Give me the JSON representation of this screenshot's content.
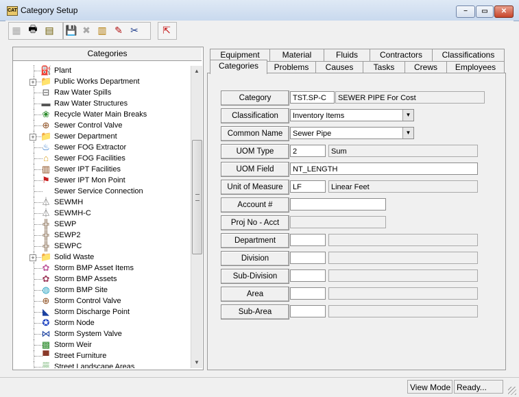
{
  "window": {
    "title": "Category Setup",
    "icon_text": "CAT"
  },
  "window_controls": {
    "minimize": "−",
    "maximize": "▭",
    "close": "✕"
  },
  "toolbar": {
    "icons": [
      "new-icon",
      "print-icon",
      "report-icon",
      "save-icon",
      "delete-icon",
      "stack-icon",
      "edit-pencil-icon",
      "cut-icon",
      "export-icon"
    ],
    "glyphs": [
      "▦",
      "🖶",
      "▤",
      "💾",
      "✖",
      "▥",
      "✎",
      "✂",
      "⇱"
    ]
  },
  "left_panel": {
    "header": "Categories"
  },
  "tree": {
    "items": [
      {
        "label": "Plant",
        "icon": "pipe-icon",
        "glyph": "⛽",
        "expandable": false
      },
      {
        "label": "Public Works Department",
        "icon": "folder-icon",
        "glyph": "📁",
        "expandable": true
      },
      {
        "label": "Raw Water Spills",
        "icon": "valve-icon",
        "glyph": "⊟",
        "expandable": false
      },
      {
        "label": "Raw Water Structures",
        "icon": "structure-icon",
        "glyph": "▬",
        "expandable": false
      },
      {
        "label": "Recycle Water Main Breaks",
        "icon": "tree-icon",
        "glyph": "❀",
        "expandable": false
      },
      {
        "label": "Sewer Control Valve",
        "icon": "valve-icon",
        "glyph": "⊕",
        "expandable": false
      },
      {
        "label": "Sewer Department",
        "icon": "folder-icon",
        "glyph": "📁",
        "expandable": true
      },
      {
        "label": "Sewer FOG Extractor",
        "icon": "extractor-icon",
        "glyph": "♨",
        "expandable": false
      },
      {
        "label": "Sewer FOG Facilities",
        "icon": "house-icon",
        "glyph": "⌂",
        "expandable": false
      },
      {
        "label": "Sewer IPT Facilities",
        "icon": "building-icon",
        "glyph": "▥",
        "expandable": false
      },
      {
        "label": "Sewer IPT Mon Point",
        "icon": "flag-icon",
        "glyph": "⚑",
        "expandable": false
      },
      {
        "label": "Sewer Service Connection",
        "icon": "",
        "glyph": "",
        "expandable": false
      },
      {
        "label": "SEWMH",
        "icon": "manhole-icon",
        "glyph": "⏃",
        "expandable": false
      },
      {
        "label": "SEWMH-C",
        "icon": "manhole-icon",
        "glyph": "⏃",
        "expandable": false
      },
      {
        "label": "SEWP",
        "icon": "pipe-segment-icon",
        "glyph": "╬",
        "expandable": false
      },
      {
        "label": "SEWP2",
        "icon": "pipe-segment-icon",
        "glyph": "╬",
        "expandable": false
      },
      {
        "label": "SEWPC",
        "icon": "pipe-segment-icon",
        "glyph": "╬",
        "expandable": false
      },
      {
        "label": "Solid Waste",
        "icon": "folder-icon",
        "glyph": "📁",
        "expandable": true
      },
      {
        "label": "Storm BMP Asset Items",
        "icon": "flower-icon",
        "glyph": "✿",
        "expandable": false
      },
      {
        "label": "Storm BMP Assets",
        "icon": "flower-icon",
        "glyph": "✿",
        "expandable": false
      },
      {
        "label": "Storm BMP Site",
        "icon": "globe-icon",
        "glyph": "◍",
        "expandable": false
      },
      {
        "label": "Storm Control Valve",
        "icon": "valve-icon",
        "glyph": "⊕",
        "expandable": false
      },
      {
        "label": "Storm Discharge Point",
        "icon": "discharge-icon",
        "glyph": "◣",
        "expandable": false
      },
      {
        "label": "Storm Node",
        "icon": "node-icon",
        "glyph": "✪",
        "expandable": false
      },
      {
        "label": "Storm System Valve",
        "icon": "valve-icon",
        "glyph": "⋈",
        "expandable": false
      },
      {
        "label": "Storm Weir",
        "icon": "weir-icon",
        "glyph": "▩",
        "expandable": false
      },
      {
        "label": "Street Furniture",
        "icon": "bench-icon",
        "glyph": "▀",
        "expandable": false
      },
      {
        "label": "Street Landscape Areas",
        "icon": "landscape-icon",
        "glyph": "▒",
        "expandable": false
      }
    ]
  },
  "tabs": {
    "back_row": [
      "Equipment",
      "Material",
      "Fluids",
      "Contractors",
      "Classifications"
    ],
    "front_row": [
      "Categories",
      "Problems",
      "Causes",
      "Tasks",
      "Crews",
      "Employees"
    ],
    "active": "Categories"
  },
  "form": {
    "category": {
      "label": "Category",
      "code": "TST.SP-C",
      "description": "SEWER PIPE For Cost"
    },
    "classification": {
      "label": "Classification",
      "value": "Inventory Items"
    },
    "common_name": {
      "label": "Common  Name",
      "value": "Sewer Pipe"
    },
    "uom_type": {
      "label": "UOM Type",
      "code": "2",
      "description": "Sum"
    },
    "uom_field": {
      "label": "UOM Field",
      "value": "NT_LENGTH"
    },
    "unit_of_measure": {
      "label": "Unit of Measure",
      "code": "LF",
      "description": "Linear Feet"
    },
    "account": {
      "label": "Account #",
      "value": ""
    },
    "proj_no": {
      "label": "Proj No - Acct",
      "value": ""
    },
    "department": {
      "label": "Department",
      "code": "",
      "description": ""
    },
    "division": {
      "label": "Division",
      "code": "",
      "description": ""
    },
    "sub_division": {
      "label": "Sub-Division",
      "code": "",
      "description": ""
    },
    "area": {
      "label": "Area",
      "code": "",
      "description": ""
    },
    "sub_area": {
      "label": "Sub-Area",
      "code": "",
      "description": ""
    }
  },
  "status": {
    "mode": "View Mode",
    "state": "Ready..."
  }
}
